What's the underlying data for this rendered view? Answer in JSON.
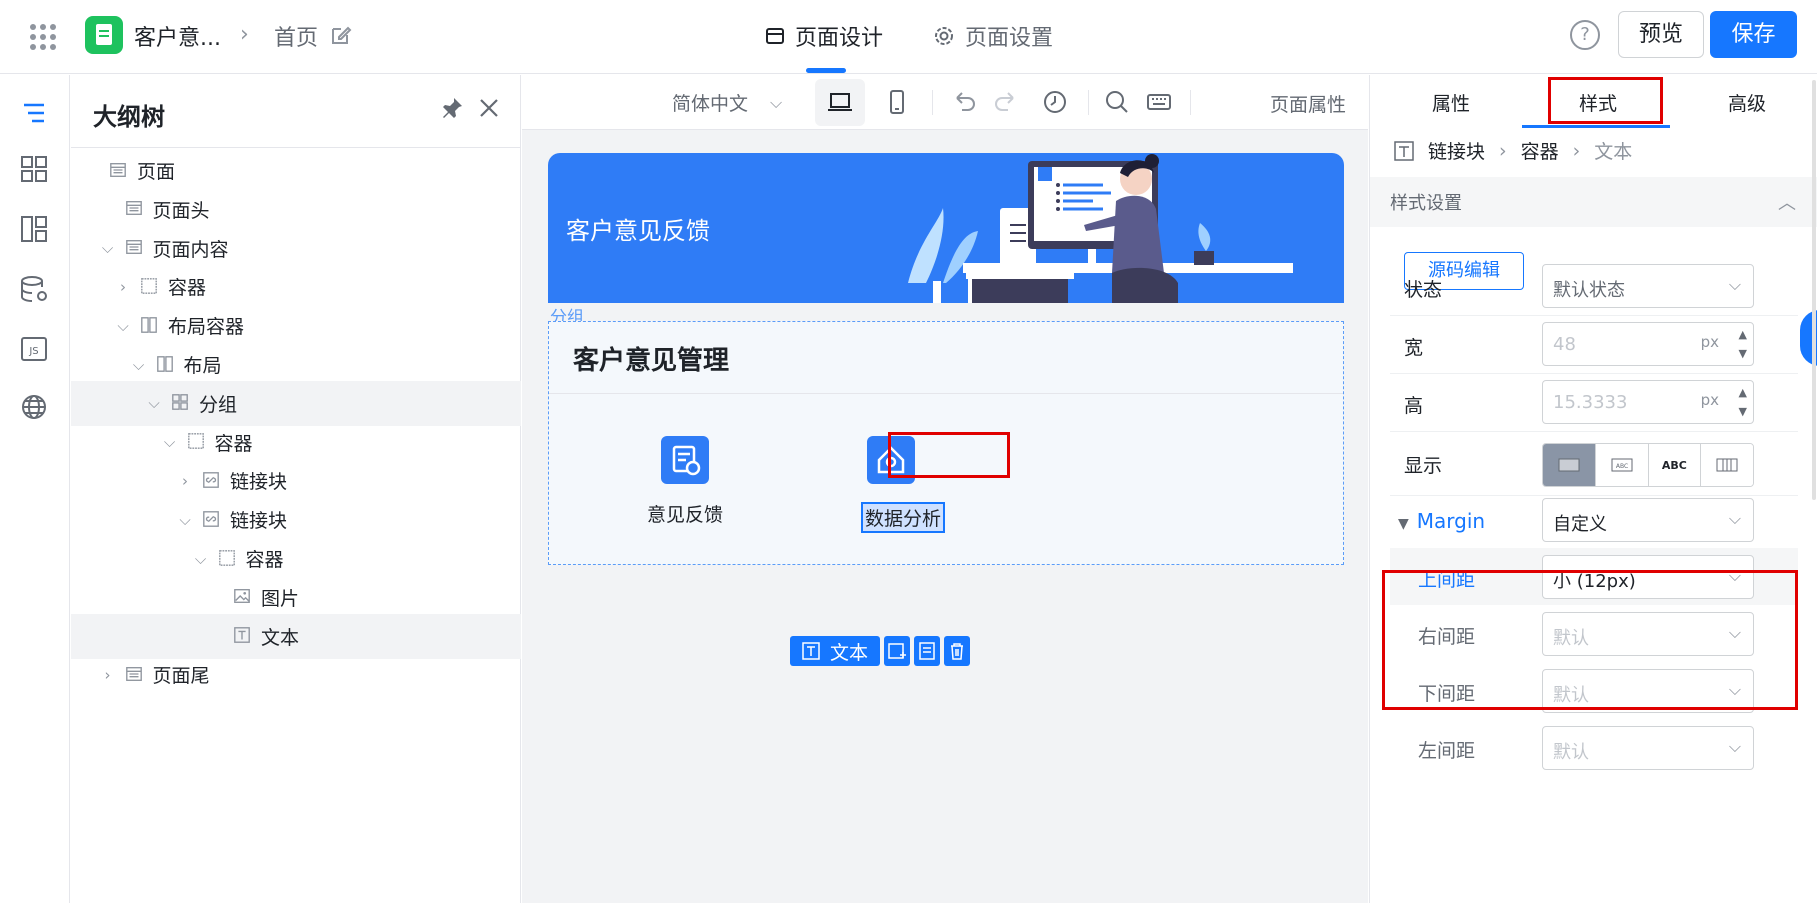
{
  "header": {
    "app_title": "客户意...",
    "breadcrumb_sep": "›",
    "breadcrumb_home": "首页",
    "tabs": [
      {
        "label": "页面设计",
        "icon": "layout-icon",
        "active": true
      },
      {
        "label": "页面设置",
        "icon": "gear-icon",
        "active": false
      }
    ],
    "help": "?",
    "preview_label": "预览",
    "save_label": "保存",
    "accent": "#1677ff"
  },
  "left_rail": {
    "icons": [
      "outline-tree-icon",
      "components-icon",
      "layout-template-icon",
      "data-source-icon",
      "js-code-icon",
      "globe-icon"
    ]
  },
  "outline": {
    "title": "大纲树",
    "rows": [
      {
        "label": "页面",
        "arrow": "",
        "icon": "page-icon",
        "level": 0
      },
      {
        "label": "页面头",
        "arrow": "",
        "icon": "page-icon",
        "level": 1
      },
      {
        "label": "页面内容",
        "arrow": "⌵",
        "icon": "page-icon",
        "level": 1
      },
      {
        "label": "容器",
        "arrow": "›",
        "icon": "container-icon",
        "level": 2
      },
      {
        "label": "布局容器",
        "arrow": "⌵",
        "icon": "columns-icon",
        "level": 2
      },
      {
        "label": "布局",
        "arrow": "⌵",
        "icon": "columns-icon",
        "level": 3
      },
      {
        "label": "分组",
        "arrow": "⌵",
        "icon": "group-icon",
        "level": 4
      },
      {
        "label": "容器",
        "arrow": "⌵",
        "icon": "container-icon",
        "level": 5
      },
      {
        "label": "链接块",
        "arrow": "›",
        "icon": "link-icon",
        "level": 6
      },
      {
        "label": "链接块",
        "arrow": "⌵",
        "icon": "link-icon",
        "level": 6
      },
      {
        "label": "容器",
        "arrow": "⌵",
        "icon": "container-icon",
        "level": 7
      },
      {
        "label": "图片",
        "arrow": "",
        "icon": "image-icon",
        "level": 8
      },
      {
        "label": "文本",
        "arrow": "",
        "icon": "text-icon",
        "level": 8
      },
      {
        "label": "页面尾",
        "arrow": "›",
        "icon": "page-icon",
        "level": 1
      }
    ]
  },
  "canvas_toolbar": {
    "language": "简体中文",
    "page_props": "页面属性"
  },
  "canvas": {
    "banner_title": "客户意见反馈",
    "group_label": "分组",
    "group_title": "客户意见管理",
    "tiles": [
      {
        "label": "意见反馈",
        "icon": "feedback-doc-icon"
      },
      {
        "label": "数据分析",
        "icon": "data-analysis-icon"
      }
    ],
    "selection_chip": "文本",
    "banner_color": "#2f7cf6"
  },
  "right_panel": {
    "tabs": [
      "属性",
      "样式",
      "高级"
    ],
    "active_tab": "样式",
    "breadcrumb": [
      "链接块",
      "容器",
      "文本"
    ],
    "section_title": "样式设置",
    "source_edit": "源码编辑",
    "state_label": "状态",
    "state_value": "默认状态",
    "width_label": "宽",
    "width_value": "48",
    "height_label": "高",
    "height_value": "15.3333",
    "unit": "px",
    "display_label": "显示",
    "display_options": [
      "block",
      "inline",
      "ABC",
      "flex"
    ],
    "display_text_abc": "ABC",
    "margin_label": "Margin",
    "margin_value": "自定义",
    "top_label": "上间距",
    "top_value": "小 (12px)",
    "right_label": "右间距",
    "right_value": "默认",
    "bottom_label": "下间距",
    "bottom_value": "默认",
    "left_label": "左间距",
    "left_value": "默认"
  }
}
